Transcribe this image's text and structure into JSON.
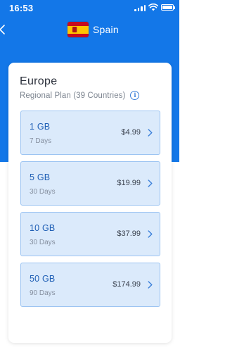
{
  "status_bar": {
    "time": "16:53"
  },
  "header": {
    "title": "Spain",
    "back_icon": "chevron-left-icon",
    "flag_icon": "spain-flag-icon"
  },
  "region": {
    "title": "Europe",
    "subtitle": "Regional Plan (39 Countries)",
    "info_icon_glyph": "i"
  },
  "plans": [
    {
      "size": "1 GB",
      "days": "7 Days",
      "price": "$4.99"
    },
    {
      "size": "5 GB",
      "days": "30 Days",
      "price": "$19.99"
    },
    {
      "size": "10 GB",
      "days": "30 Days",
      "price": "$37.99"
    },
    {
      "size": "50 GB",
      "days": "90 Days",
      "price": "$174.99"
    }
  ],
  "colors": {
    "accent_blue": "#1377e8",
    "plan_background": "#dbeafb",
    "plan_border": "#9cc4f2",
    "plan_size_text": "#1f5fb5"
  }
}
